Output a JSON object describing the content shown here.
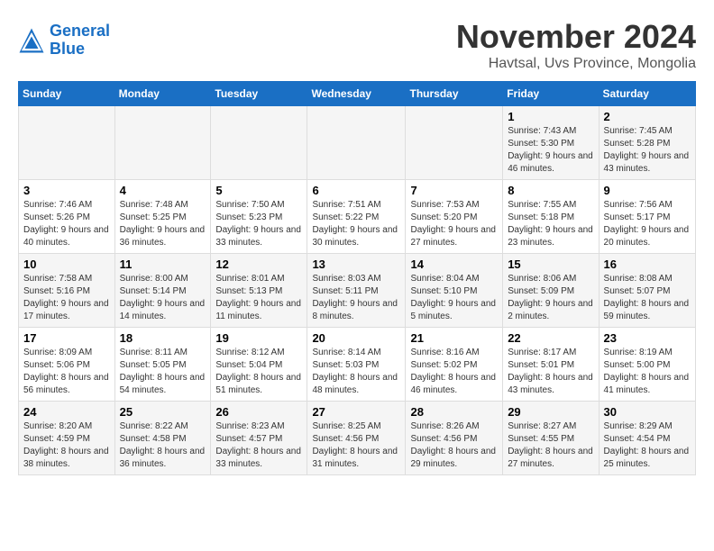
{
  "header": {
    "logo_line1": "General",
    "logo_line2": "Blue",
    "month_title": "November 2024",
    "location": "Havtsal, Uvs Province, Mongolia"
  },
  "weekdays": [
    "Sunday",
    "Monday",
    "Tuesday",
    "Wednesday",
    "Thursday",
    "Friday",
    "Saturday"
  ],
  "weeks": [
    [
      {
        "day": "",
        "sunrise": "",
        "sunset": "",
        "daylight": ""
      },
      {
        "day": "",
        "sunrise": "",
        "sunset": "",
        "daylight": ""
      },
      {
        "day": "",
        "sunrise": "",
        "sunset": "",
        "daylight": ""
      },
      {
        "day": "",
        "sunrise": "",
        "sunset": "",
        "daylight": ""
      },
      {
        "day": "",
        "sunrise": "",
        "sunset": "",
        "daylight": ""
      },
      {
        "day": "1",
        "sunrise": "Sunrise: 7:43 AM",
        "sunset": "Sunset: 5:30 PM",
        "daylight": "Daylight: 9 hours and 46 minutes."
      },
      {
        "day": "2",
        "sunrise": "Sunrise: 7:45 AM",
        "sunset": "Sunset: 5:28 PM",
        "daylight": "Daylight: 9 hours and 43 minutes."
      }
    ],
    [
      {
        "day": "3",
        "sunrise": "Sunrise: 7:46 AM",
        "sunset": "Sunset: 5:26 PM",
        "daylight": "Daylight: 9 hours and 40 minutes."
      },
      {
        "day": "4",
        "sunrise": "Sunrise: 7:48 AM",
        "sunset": "Sunset: 5:25 PM",
        "daylight": "Daylight: 9 hours and 36 minutes."
      },
      {
        "day": "5",
        "sunrise": "Sunrise: 7:50 AM",
        "sunset": "Sunset: 5:23 PM",
        "daylight": "Daylight: 9 hours and 33 minutes."
      },
      {
        "day": "6",
        "sunrise": "Sunrise: 7:51 AM",
        "sunset": "Sunset: 5:22 PM",
        "daylight": "Daylight: 9 hours and 30 minutes."
      },
      {
        "day": "7",
        "sunrise": "Sunrise: 7:53 AM",
        "sunset": "Sunset: 5:20 PM",
        "daylight": "Daylight: 9 hours and 27 minutes."
      },
      {
        "day": "8",
        "sunrise": "Sunrise: 7:55 AM",
        "sunset": "Sunset: 5:18 PM",
        "daylight": "Daylight: 9 hours and 23 minutes."
      },
      {
        "day": "9",
        "sunrise": "Sunrise: 7:56 AM",
        "sunset": "Sunset: 5:17 PM",
        "daylight": "Daylight: 9 hours and 20 minutes."
      }
    ],
    [
      {
        "day": "10",
        "sunrise": "Sunrise: 7:58 AM",
        "sunset": "Sunset: 5:16 PM",
        "daylight": "Daylight: 9 hours and 17 minutes."
      },
      {
        "day": "11",
        "sunrise": "Sunrise: 8:00 AM",
        "sunset": "Sunset: 5:14 PM",
        "daylight": "Daylight: 9 hours and 14 minutes."
      },
      {
        "day": "12",
        "sunrise": "Sunrise: 8:01 AM",
        "sunset": "Sunset: 5:13 PM",
        "daylight": "Daylight: 9 hours and 11 minutes."
      },
      {
        "day": "13",
        "sunrise": "Sunrise: 8:03 AM",
        "sunset": "Sunset: 5:11 PM",
        "daylight": "Daylight: 9 hours and 8 minutes."
      },
      {
        "day": "14",
        "sunrise": "Sunrise: 8:04 AM",
        "sunset": "Sunset: 5:10 PM",
        "daylight": "Daylight: 9 hours and 5 minutes."
      },
      {
        "day": "15",
        "sunrise": "Sunrise: 8:06 AM",
        "sunset": "Sunset: 5:09 PM",
        "daylight": "Daylight: 9 hours and 2 minutes."
      },
      {
        "day": "16",
        "sunrise": "Sunrise: 8:08 AM",
        "sunset": "Sunset: 5:07 PM",
        "daylight": "Daylight: 8 hours and 59 minutes."
      }
    ],
    [
      {
        "day": "17",
        "sunrise": "Sunrise: 8:09 AM",
        "sunset": "Sunset: 5:06 PM",
        "daylight": "Daylight: 8 hours and 56 minutes."
      },
      {
        "day": "18",
        "sunrise": "Sunrise: 8:11 AM",
        "sunset": "Sunset: 5:05 PM",
        "daylight": "Daylight: 8 hours and 54 minutes."
      },
      {
        "day": "19",
        "sunrise": "Sunrise: 8:12 AM",
        "sunset": "Sunset: 5:04 PM",
        "daylight": "Daylight: 8 hours and 51 minutes."
      },
      {
        "day": "20",
        "sunrise": "Sunrise: 8:14 AM",
        "sunset": "Sunset: 5:03 PM",
        "daylight": "Daylight: 8 hours and 48 minutes."
      },
      {
        "day": "21",
        "sunrise": "Sunrise: 8:16 AM",
        "sunset": "Sunset: 5:02 PM",
        "daylight": "Daylight: 8 hours and 46 minutes."
      },
      {
        "day": "22",
        "sunrise": "Sunrise: 8:17 AM",
        "sunset": "Sunset: 5:01 PM",
        "daylight": "Daylight: 8 hours and 43 minutes."
      },
      {
        "day": "23",
        "sunrise": "Sunrise: 8:19 AM",
        "sunset": "Sunset: 5:00 PM",
        "daylight": "Daylight: 8 hours and 41 minutes."
      }
    ],
    [
      {
        "day": "24",
        "sunrise": "Sunrise: 8:20 AM",
        "sunset": "Sunset: 4:59 PM",
        "daylight": "Daylight: 8 hours and 38 minutes."
      },
      {
        "day": "25",
        "sunrise": "Sunrise: 8:22 AM",
        "sunset": "Sunset: 4:58 PM",
        "daylight": "Daylight: 8 hours and 36 minutes."
      },
      {
        "day": "26",
        "sunrise": "Sunrise: 8:23 AM",
        "sunset": "Sunset: 4:57 PM",
        "daylight": "Daylight: 8 hours and 33 minutes."
      },
      {
        "day": "27",
        "sunrise": "Sunrise: 8:25 AM",
        "sunset": "Sunset: 4:56 PM",
        "daylight": "Daylight: 8 hours and 31 minutes."
      },
      {
        "day": "28",
        "sunrise": "Sunrise: 8:26 AM",
        "sunset": "Sunset: 4:56 PM",
        "daylight": "Daylight: 8 hours and 29 minutes."
      },
      {
        "day": "29",
        "sunrise": "Sunrise: 8:27 AM",
        "sunset": "Sunset: 4:55 PM",
        "daylight": "Daylight: 8 hours and 27 minutes."
      },
      {
        "day": "30",
        "sunrise": "Sunrise: 8:29 AM",
        "sunset": "Sunset: 4:54 PM",
        "daylight": "Daylight: 8 hours and 25 minutes."
      }
    ]
  ]
}
